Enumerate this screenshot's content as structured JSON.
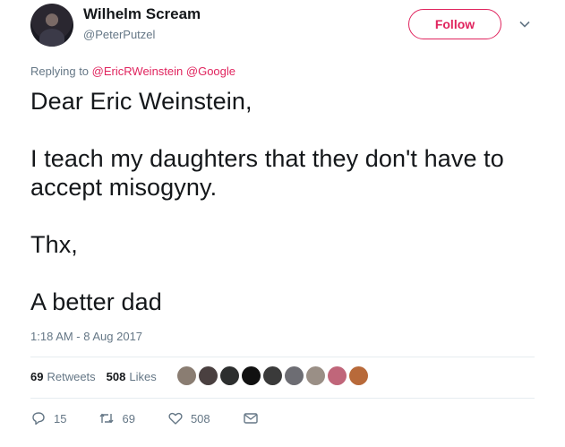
{
  "author": {
    "name": "Wilhelm Scream",
    "handle": "@PeterPutzel"
  },
  "follow_label": "Follow",
  "reply": {
    "prefix": "Replying to",
    "mention_1": "@EricRWeinstein",
    "mention_2": "@Google"
  },
  "tweet": {
    "line_1": "Dear Eric Weinstein,",
    "line_2": "I teach my daughters that they don't have to accept misogyny.",
    "line_3": "Thx,",
    "line_4": "A better dad"
  },
  "timestamp": "1:18 AM - 8 Aug 2017",
  "stats": {
    "retweets_count": "69",
    "retweets_label": "Retweets",
    "likes_count": "508",
    "likes_label": "Likes"
  },
  "liker_colors": [
    "#8a7d72",
    "#4a4040",
    "#2d2f2f",
    "#111111",
    "#3a3a3a",
    "#6d6d73",
    "#9a8f86",
    "#c0667a",
    "#b86a3a"
  ],
  "actions": {
    "replies": "15",
    "retweets": "69",
    "likes": "508"
  },
  "colors": {
    "accent": "#e0245e",
    "muted": "#657786",
    "text": "#14171a",
    "divider": "#e6ecf0"
  }
}
